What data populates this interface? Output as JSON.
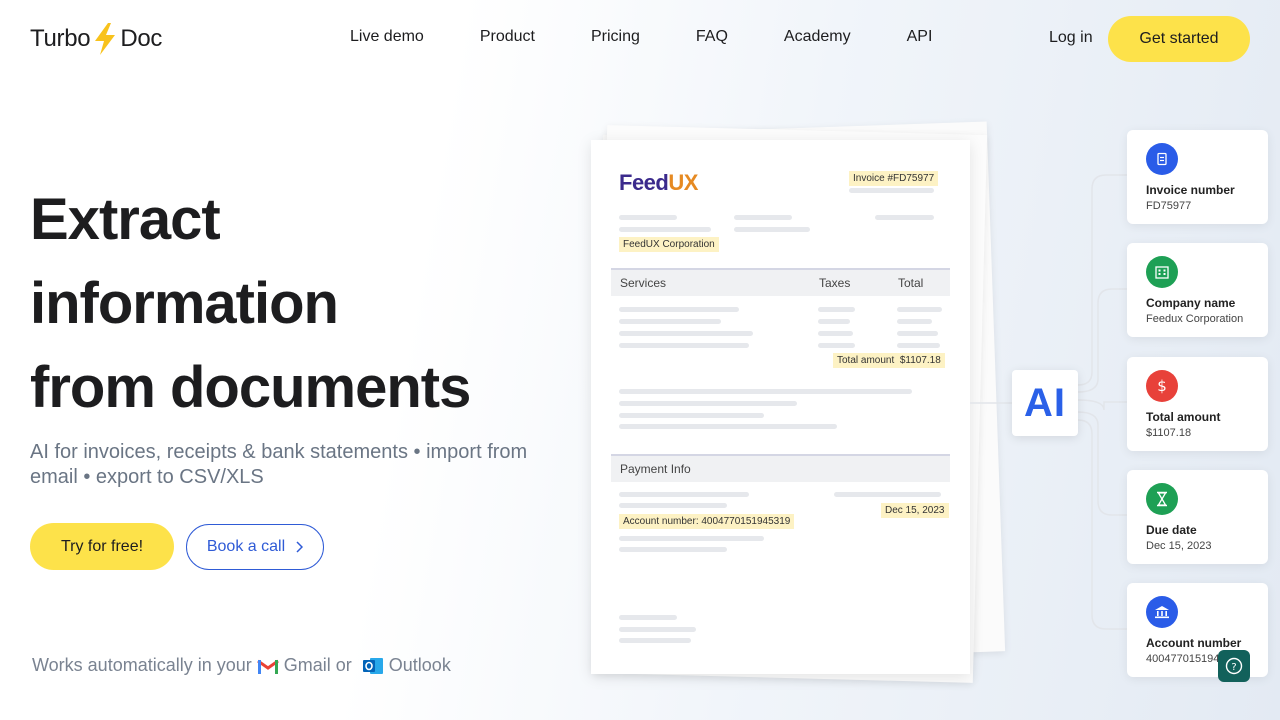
{
  "header": {
    "logo_left": "Turbo",
    "logo_right": "Doc",
    "nav": [
      "Live demo",
      "Product",
      "Pricing",
      "FAQ",
      "Academy",
      "API"
    ],
    "login": "Log in",
    "get_started": "Get started"
  },
  "hero": {
    "headline": [
      "Extract",
      "information",
      "from documents"
    ],
    "subhead": "AI for invoices, receipts & bank statements • import from email • export to CSV/XLS",
    "try_free": "Try for free!",
    "book_call": "Book a call",
    "works_prefix": "Works automatically in your",
    "gmail": "Gmail",
    "or": "or",
    "outlook": "Outlook"
  },
  "invoice": {
    "brand_a": "Feed",
    "brand_b": "UX",
    "invoice_no": "Invoice #FD75977",
    "company": "FeedUX Corporation",
    "col_services": "Services",
    "col_taxes": "Taxes",
    "col_total": "Total",
    "total_label": "Total amount",
    "total_value": "$1107.18",
    "payment_info": "Payment Info",
    "account": "Account number: 4004770151945319",
    "due": "Dec 15, 2023"
  },
  "ai_label": "AI",
  "fields": [
    {
      "title": "Invoice number",
      "value": "FD75977",
      "icon": "document-icon",
      "color": "#2a5ce8"
    },
    {
      "title": "Company name",
      "value": "Feedux Corporation",
      "icon": "building-icon",
      "color": "#1ea055"
    },
    {
      "title": "Total amount",
      "value": "$1107.18",
      "icon": "dollar-icon",
      "color": "#e8413a"
    },
    {
      "title": "Due date",
      "value": "Dec 15, 2023",
      "icon": "hourglass-icon",
      "color": "#1ea055"
    },
    {
      "title": "Account number",
      "value": "4004770151945319",
      "icon": "bank-icon",
      "color": "#2a5ce8"
    }
  ],
  "colors": {
    "accent_yellow": "#fde24a",
    "link_blue": "#2f5bd6",
    "help_teal": "#12615b"
  }
}
